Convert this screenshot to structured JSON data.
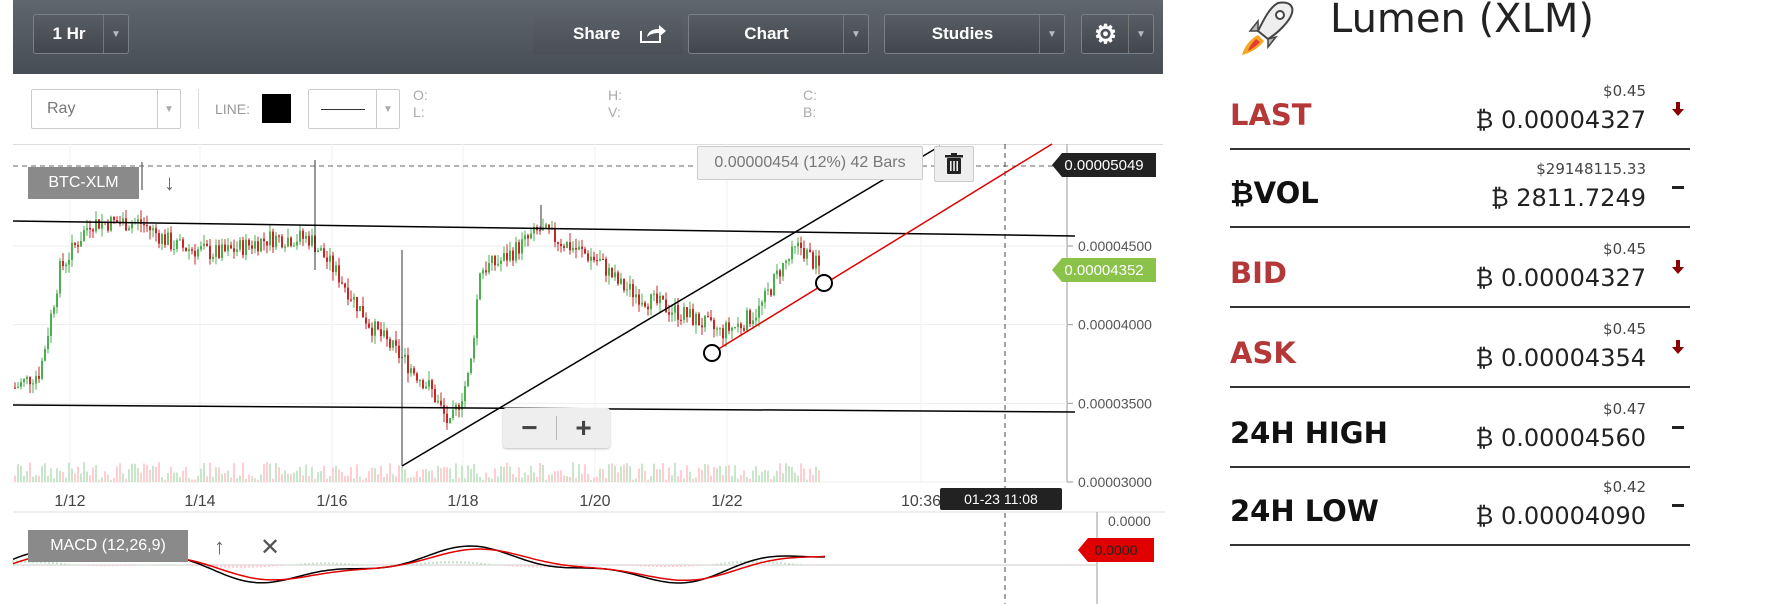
{
  "toolbar": {
    "interval_label": "1 Hr",
    "share_label": "Share",
    "chart_label": "Chart",
    "studies_label": "Studies"
  },
  "drawing_bar": {
    "tool_value": "Ray",
    "line_label": "LINE:",
    "line_color": "#000000",
    "ohlc": {
      "o": "O:",
      "h": "H:",
      "c": "C:",
      "l": "L:",
      "v": "V:",
      "b": "B:"
    }
  },
  "chart": {
    "symbol": "BTC-XLM",
    "measure_tooltip": "0.00000454 (12%) 42 Bars",
    "price_tags": {
      "top": "0.00005049",
      "last": "0.00004352"
    },
    "y_ticks": [
      "0.00004500",
      "0.00004000",
      "0.00003500",
      "0.00003000"
    ],
    "x_ticks": [
      "1/12",
      "1/14",
      "1/16",
      "1/18",
      "1/20",
      "1/22",
      "10:36"
    ],
    "crosshair_time": "01-23 11:08",
    "macd_label": "MACD (12,26,9)",
    "macd_ticks": [
      "0.0000"
    ],
    "macd_value": "0.0000",
    "colors": {
      "up": "#4caf50",
      "down": "#c62828",
      "macd_line": "#000000",
      "signal_line": "#e00000",
      "last_tag": "#8bc34a"
    }
  },
  "market": {
    "title": "Lumen (XLM)",
    "stats": [
      {
        "label": "LAST",
        "usd": "$0.45",
        "btc": "₿ 0.00004327",
        "trend": "down",
        "color": "red"
      },
      {
        "label": "₿VOL",
        "usd": "$29148115.33",
        "btc": "₿ 2811.7249",
        "trend": "flat",
        "color": "dark"
      },
      {
        "label": "BID",
        "usd": "$0.45",
        "btc": "₿ 0.00004327",
        "trend": "down",
        "color": "red"
      },
      {
        "label": "ASK",
        "usd": "$0.45",
        "btc": "₿ 0.00004354",
        "trend": "down",
        "color": "red"
      },
      {
        "label": "24H HIGH",
        "usd": "$0.47",
        "btc": "₿ 0.00004560",
        "trend": "flat",
        "color": "dark"
      },
      {
        "label": "24H LOW",
        "usd": "$0.42",
        "btc": "₿ 0.00004090",
        "trend": "flat",
        "color": "dark"
      }
    ]
  }
}
